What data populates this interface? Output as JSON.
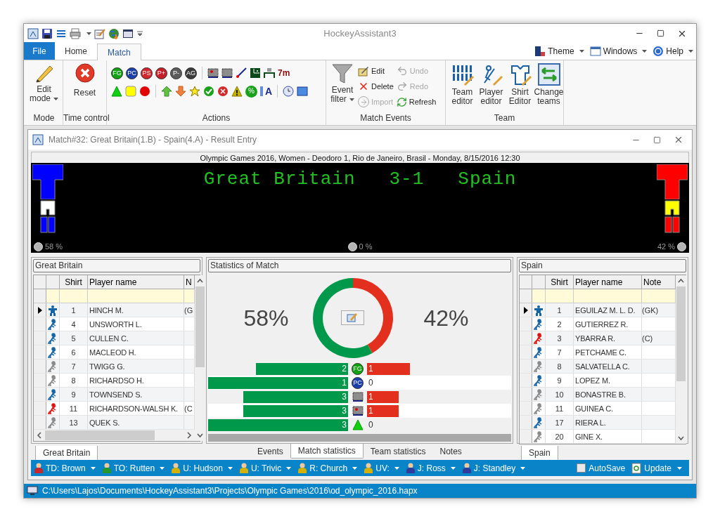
{
  "window": {
    "title": "HockeyAssistant3"
  },
  "ribbon_tabs": [
    {
      "label": "File",
      "kind": "file",
      "selected": false
    },
    {
      "label": "Home",
      "kind": "tab",
      "selected": false
    },
    {
      "label": "Match",
      "kind": "tab",
      "selected": true
    }
  ],
  "ribbon_menus": [
    {
      "label": "Theme",
      "kind": "theme"
    },
    {
      "label": "Windows",
      "kind": "windows"
    },
    {
      "label": "Help",
      "kind": "help"
    }
  ],
  "ribbon_groups": {
    "mode": {
      "label": "Mode",
      "button": "Edit mode"
    },
    "time": {
      "label": "Time control",
      "button": "Reset"
    },
    "actions": {
      "label": "Actions",
      "badges": [
        {
          "text": "FG",
          "color": "#12a112"
        },
        {
          "text": "PC",
          "color": "#1c3fae"
        },
        {
          "text": "PS",
          "color": "#d2262c"
        },
        {
          "text": "P+",
          "color": "#c81f2b"
        },
        {
          "text": "P-",
          "color": "#5c5c5c"
        },
        {
          "text": "AG",
          "color": "#3a3a3a"
        }
      ],
      "seven_m": "7m",
      "symbols": [
        {
          "text": "%",
          "kind": "percent"
        },
        {
          "text": "A",
          "kind": "letter"
        }
      ]
    },
    "events": {
      "label": "Match Events",
      "filter": "Event filter",
      "items": [
        {
          "label": "Edit",
          "kind": "edit",
          "disabled": false
        },
        {
          "label": "Delete",
          "kind": "delete",
          "disabled": false
        },
        {
          "label": "Import",
          "kind": "import",
          "disabled": true
        },
        {
          "label": "Undo",
          "kind": "undo",
          "disabled": true
        },
        {
          "label": "Redo",
          "kind": "redo",
          "disabled": true
        },
        {
          "label": "Refresh",
          "kind": "refresh",
          "disabled": false
        }
      ]
    },
    "team": {
      "label": "Team",
      "buttons": [
        {
          "label": "Team editor",
          "kind": "team"
        },
        {
          "label": "Player editor",
          "kind": "player"
        },
        {
          "label": "Shirt Editor",
          "kind": "shirt"
        },
        {
          "label": "Change teams",
          "kind": "swap"
        }
      ]
    }
  },
  "match_window": {
    "title": "Match#32: Great Britain(1.B) - Spain(4.A) - Result Entry",
    "venue": "Olympic Games 2016, Women - Deodoro 1, Rio de Janeiro, Brasil - Monday, 8/15/2016 12:30",
    "scoreboard": {
      "home": "Great Britain",
      "score": "3-1",
      "away": "Spain",
      "home_pct": "58 %",
      "mid_pct": "0 %",
      "away_pct": "42 %",
      "home_kit": [
        {
          "kind": "shirt",
          "color": "#0000ff"
        },
        {
          "kind": "shorts",
          "color": "#ffffff"
        },
        {
          "kind": "socks",
          "color": "#0000ff"
        }
      ],
      "away_kit": [
        {
          "kind": "shirt",
          "color": "#ff0000"
        },
        {
          "kind": "shorts",
          "color": "#ffff00"
        },
        {
          "kind": "socks",
          "color": "#ff0000"
        }
      ]
    },
    "teams": [
      {
        "caption": "Great Britain",
        "columns": [
          "Shirt",
          "Player name",
          "N"
        ],
        "tab": {
          "label": "Great Britain",
          "selected": true
        },
        "rows": [
          {
            "selected": true,
            "kind": "keeper",
            "shirt": "1",
            "name": "HINCH M.",
            "note": "(G"
          },
          {
            "selected": false,
            "kind": "active",
            "shirt": "4",
            "name": "UNSWORTH L."
          },
          {
            "selected": false,
            "kind": "active",
            "shirt": "5",
            "name": "CULLEN C."
          },
          {
            "selected": false,
            "kind": "active",
            "shirt": "6",
            "name": "MACLEOD H."
          },
          {
            "selected": false,
            "kind": "bench",
            "shirt": "7",
            "name": "TWIGG G."
          },
          {
            "selected": false,
            "kind": "bench",
            "shirt": "8",
            "name": "RICHARDSO H."
          },
          {
            "selected": false,
            "kind": "active",
            "shirt": "9",
            "name": "TOWNSEND S."
          },
          {
            "selected": false,
            "kind": "captain",
            "shirt": "11",
            "name": "RICHARDSON-WALSH K.",
            "note": "(C"
          },
          {
            "selected": false,
            "kind": "bench",
            "shirt": "13",
            "name": "QUEK S."
          }
        ]
      },
      {
        "caption": "Spain",
        "columns": [
          "Shirt",
          "Player name",
          "Note"
        ],
        "tab": {
          "label": "Spain",
          "selected": true
        },
        "rows": [
          {
            "selected": true,
            "kind": "keeper",
            "shirt": "1",
            "name": "EGUILAZ M. L. D.",
            "note": "(GK)"
          },
          {
            "selected": false,
            "kind": "active",
            "shirt": "2",
            "name": "GUTIERREZ R."
          },
          {
            "selected": false,
            "kind": "captain",
            "shirt": "3",
            "name": "YBARRA R.",
            "note": "(C)"
          },
          {
            "selected": false,
            "kind": "active",
            "shirt": "7",
            "name": "PETCHAME C."
          },
          {
            "selected": false,
            "kind": "bench",
            "shirt": "8",
            "name": "SALVATELLA C."
          },
          {
            "selected": false,
            "kind": "active",
            "shirt": "9",
            "name": "LOPEZ M."
          },
          {
            "selected": false,
            "kind": "bench",
            "shirt": "10",
            "name": "BONASTRE B."
          },
          {
            "selected": false,
            "kind": "bench",
            "shirt": "11",
            "name": "GUINEA C."
          },
          {
            "selected": false,
            "kind": "active",
            "shirt": "17",
            "name": "RIERA L."
          },
          {
            "selected": false,
            "kind": "bench",
            "shirt": "20",
            "name": "GINE X."
          }
        ]
      }
    ],
    "stats": {
      "caption": "Statistics of Match",
      "home_pct": "58%",
      "away_pct": "42%",
      "chart_data": {
        "type": "donut",
        "values": [
          58,
          42
        ]
      },
      "rows": [
        {
          "kind": "badge",
          "text": "FG",
          "color": "#12a112",
          "home": {
            "value": "2",
            "level": 0.66
          },
          "away": {
            "value": "1",
            "level": 0.31
          }
        },
        {
          "kind": "badge",
          "text": "PC",
          "color": "#1c3fae",
          "home": {
            "value": "1",
            "level": 1
          },
          "away": {
            "value": "0",
            "level": 0
          }
        },
        {
          "kind": "checkered",
          "home": {
            "value": "3",
            "level": 0.75
          },
          "away": {
            "value": "1",
            "level": 0.23
          }
        },
        {
          "kind": "checkered-dot",
          "home": {
            "value": "3",
            "level": 0.75
          },
          "away": {
            "value": "1",
            "level": 0.23
          }
        },
        {
          "kind": "triangle",
          "home": {
            "value": "3",
            "level": 1
          },
          "away": {
            "value": "0",
            "level": 0
          }
        }
      ],
      "tabs": [
        {
          "label": "Events",
          "selected": false
        },
        {
          "label": "Match statistics",
          "selected": true
        },
        {
          "label": "Team statistics",
          "selected": false
        },
        {
          "label": "Notes",
          "selected": false
        }
      ]
    },
    "officials": [
      {
        "label": "TD: Brown",
        "color": "#c8262c"
      },
      {
        "label": "TO: Rutten",
        "color": "#24962a"
      },
      {
        "label": "U: Hudson",
        "color": "#d4b000"
      },
      {
        "label": "U: Trivic",
        "color": "#d4b000"
      },
      {
        "label": "R: Church",
        "color": "#d4b000"
      },
      {
        "label": "UV:",
        "color": "#d4b000"
      },
      {
        "label": "J: Ross",
        "color": "#2c3c9c"
      },
      {
        "label": "J: Standley",
        "color": "#2c3c9c"
      }
    ],
    "autosave": {
      "label": "AutoSave",
      "checked": false
    },
    "update": "Update"
  },
  "status_bar": {
    "path": "C:\\Users\\Lajos\\Documents\\HockeyAssistant3\\Projects\\Olympic Games\\2016\\od_olympic_2016.hapx"
  }
}
